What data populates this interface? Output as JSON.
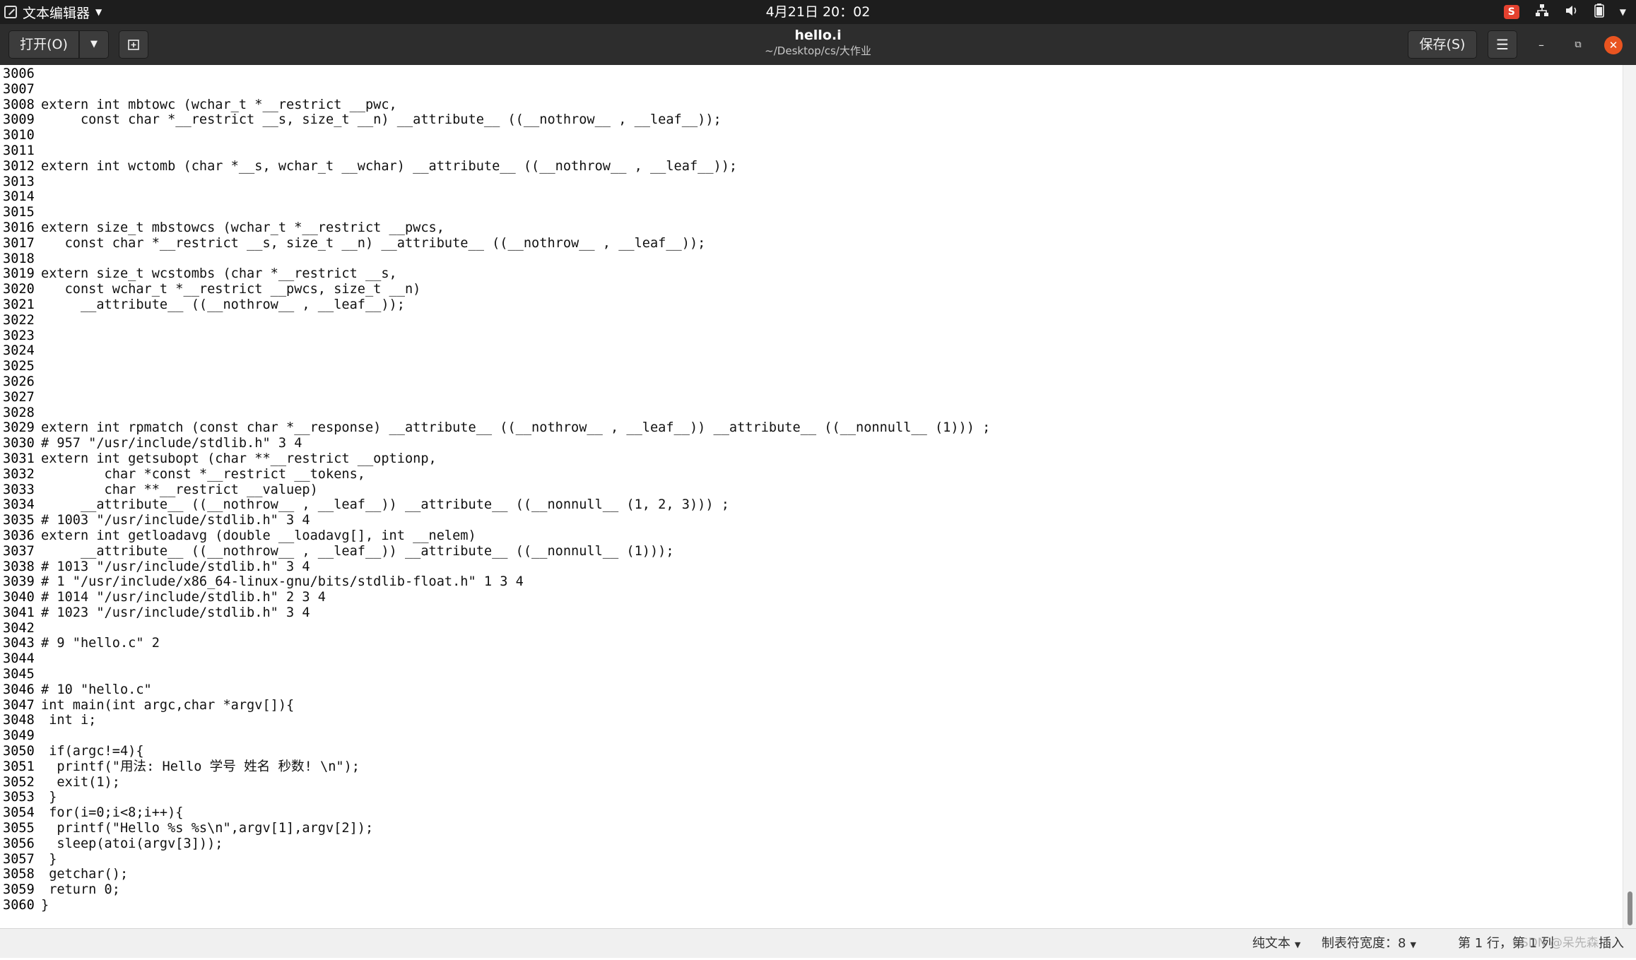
{
  "system_bar": {
    "app_name": "文本编辑器",
    "clock": "4月21日 20：02",
    "tray_logo": "S"
  },
  "header": {
    "open_label": "打开(O)",
    "title": "hello.i",
    "subtitle": "~/Desktop/cs/大作业",
    "save_label": "保存(S)"
  },
  "icons": {
    "app": "text-editor-icon",
    "new_tab": "new-tab-icon",
    "menu": "hamburger-menu-icon",
    "minimize": "minimize-icon",
    "maximize": "maximize-icon",
    "close": "close-icon",
    "network": "network-icon",
    "volume": "volume-icon",
    "battery": "battery-icon"
  },
  "lines": [
    {
      "n": "3006",
      "t": ""
    },
    {
      "n": "3007",
      "t": ""
    },
    {
      "n": "3008",
      "t": "extern int mbtowc (wchar_t *__restrict __pwc,"
    },
    {
      "n": "3009",
      "t": "     const char *__restrict __s, size_t __n) __attribute__ ((__nothrow__ , __leaf__));"
    },
    {
      "n": "3010",
      "t": ""
    },
    {
      "n": "3011",
      "t": ""
    },
    {
      "n": "3012",
      "t": "extern int wctomb (char *__s, wchar_t __wchar) __attribute__ ((__nothrow__ , __leaf__));"
    },
    {
      "n": "3013",
      "t": ""
    },
    {
      "n": "3014",
      "t": ""
    },
    {
      "n": "3015",
      "t": ""
    },
    {
      "n": "3016",
      "t": "extern size_t mbstowcs (wchar_t *__restrict __pwcs,"
    },
    {
      "n": "3017",
      "t": "   const char *__restrict __s, size_t __n) __attribute__ ((__nothrow__ , __leaf__));"
    },
    {
      "n": "3018",
      "t": ""
    },
    {
      "n": "3019",
      "t": "extern size_t wcstombs (char *__restrict __s,"
    },
    {
      "n": "3020",
      "t": "   const wchar_t *__restrict __pwcs, size_t __n)"
    },
    {
      "n": "3021",
      "t": "     __attribute__ ((__nothrow__ , __leaf__));"
    },
    {
      "n": "3022",
      "t": ""
    },
    {
      "n": "3023",
      "t": ""
    },
    {
      "n": "3024",
      "t": ""
    },
    {
      "n": "3025",
      "t": ""
    },
    {
      "n": "3026",
      "t": ""
    },
    {
      "n": "3027",
      "t": ""
    },
    {
      "n": "3028",
      "t": ""
    },
    {
      "n": "3029",
      "t": "extern int rpmatch (const char *__response) __attribute__ ((__nothrow__ , __leaf__)) __attribute__ ((__nonnull__ (1))) ;"
    },
    {
      "n": "3030",
      "t": "# 957 \"/usr/include/stdlib.h\" 3 4"
    },
    {
      "n": "3031",
      "t": "extern int getsubopt (char **__restrict __optionp,"
    },
    {
      "n": "3032",
      "t": "        char *const *__restrict __tokens,"
    },
    {
      "n": "3033",
      "t": "        char **__restrict __valuep)"
    },
    {
      "n": "3034",
      "t": "     __attribute__ ((__nothrow__ , __leaf__)) __attribute__ ((__nonnull__ (1, 2, 3))) ;"
    },
    {
      "n": "3035",
      "t": "# 1003 \"/usr/include/stdlib.h\" 3 4"
    },
    {
      "n": "3036",
      "t": "extern int getloadavg (double __loadavg[], int __nelem)"
    },
    {
      "n": "3037",
      "t": "     __attribute__ ((__nothrow__ , __leaf__)) __attribute__ ((__nonnull__ (1)));"
    },
    {
      "n": "3038",
      "t": "# 1013 \"/usr/include/stdlib.h\" 3 4"
    },
    {
      "n": "3039",
      "t": "# 1 \"/usr/include/x86_64-linux-gnu/bits/stdlib-float.h\" 1 3 4"
    },
    {
      "n": "3040",
      "t": "# 1014 \"/usr/include/stdlib.h\" 2 3 4"
    },
    {
      "n": "3041",
      "t": "# 1023 \"/usr/include/stdlib.h\" 3 4"
    },
    {
      "n": "3042",
      "t": ""
    },
    {
      "n": "3043",
      "t": "# 9 \"hello.c\" 2"
    },
    {
      "n": "3044",
      "t": ""
    },
    {
      "n": "3045",
      "t": ""
    },
    {
      "n": "3046",
      "t": "# 10 \"hello.c\""
    },
    {
      "n": "3047",
      "t": "int main(int argc,char *argv[]){"
    },
    {
      "n": "3048",
      "t": " int i;"
    },
    {
      "n": "3049",
      "t": ""
    },
    {
      "n": "3050",
      "t": " if(argc!=4){"
    },
    {
      "n": "3051",
      "t": "  printf(\"用法: Hello 学号 姓名 秒数! \\n\");"
    },
    {
      "n": "3052",
      "t": "  exit(1);"
    },
    {
      "n": "3053",
      "t": " }"
    },
    {
      "n": "3054",
      "t": " for(i=0;i<8;i++){"
    },
    {
      "n": "3055",
      "t": "  printf(\"Hello %s %s\\n\",argv[1],argv[2]);"
    },
    {
      "n": "3056",
      "t": "  sleep(atoi(argv[3]));"
    },
    {
      "n": "3057",
      "t": " }"
    },
    {
      "n": "3058",
      "t": " getchar();"
    },
    {
      "n": "3059",
      "t": " return 0;"
    },
    {
      "n": "3060",
      "t": "}"
    }
  ],
  "status_bar": {
    "language": "纯文本",
    "tab_width": "制表符宽度：8",
    "position": "第 1 行，第 1 列",
    "mode": "插入"
  },
  "watermark": "CSDN @呆先森"
}
